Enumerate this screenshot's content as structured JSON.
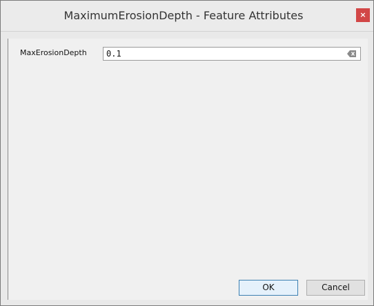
{
  "window": {
    "title": "MaximumErosionDepth - Feature Attributes",
    "close_label": "×"
  },
  "form": {
    "field_label": "MaxErosionDepth",
    "field_value": "0.1"
  },
  "buttons": {
    "ok_label": "OK",
    "cancel_label": "Cancel"
  },
  "colors": {
    "close_button": "#d24747",
    "window_bg": "#e9e9e9",
    "content_bg": "#f0f0f0"
  },
  "icons": {
    "clear": "clear-icon",
    "close": "close-icon"
  }
}
